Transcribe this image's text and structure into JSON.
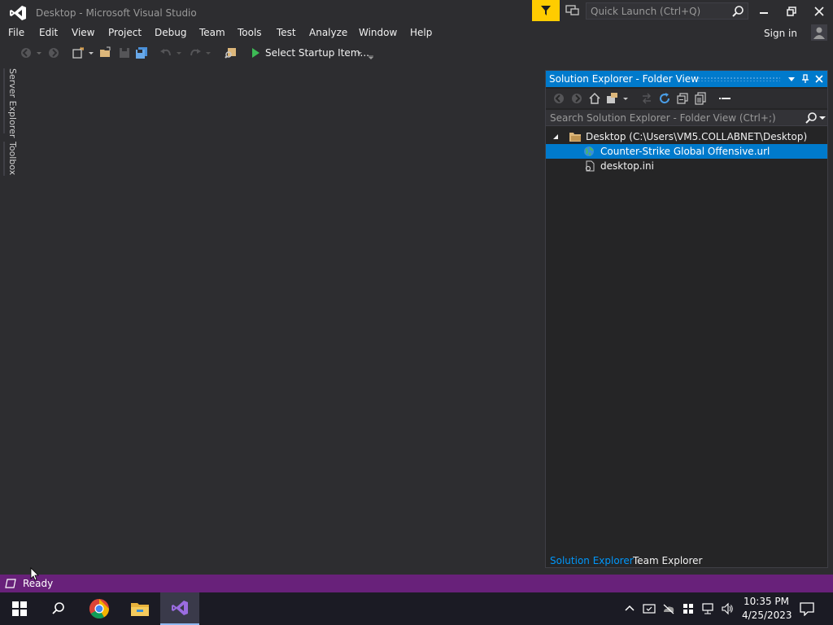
{
  "window": {
    "title": "Desktop - Microsoft Visual Studio",
    "quick_launch_placeholder": "Quick Launch (Ctrl+Q)"
  },
  "menu": {
    "items": [
      "File",
      "Edit",
      "View",
      "Project",
      "Debug",
      "Team",
      "Tools",
      "Test",
      "Analyze",
      "Window",
      "Help"
    ],
    "sign_in": "Sign in"
  },
  "toolbar": {
    "startup_label": "Select Startup Item..."
  },
  "side_tabs": [
    "Server Explorer",
    "Toolbox"
  ],
  "solution_explorer": {
    "title": "Solution Explorer - Folder View",
    "search_placeholder": "Search Solution Explorer - Folder View (Ctrl+;)",
    "tree": [
      {
        "label": "Desktop (C:\\Users\\VM5.COLLABNET\\Desktop)",
        "icon": "folder-icon",
        "expanded": true,
        "selected": false
      },
      {
        "label": "Counter-Strike Global Offensive.url",
        "icon": "globe-icon",
        "selected": true
      },
      {
        "label": "desktop.ini",
        "icon": "settings-file-icon",
        "selected": false
      }
    ],
    "tabs": [
      "Solution Explorer",
      "Team Explorer"
    ],
    "active_tab": "Solution Explorer"
  },
  "status": {
    "text": "Ready"
  },
  "clock": {
    "time": "10:35 PM",
    "date": "4/25/2023"
  },
  "colors": {
    "accent": "#007acc",
    "status_bar": "#68217a",
    "notification": "#ffcc00"
  }
}
